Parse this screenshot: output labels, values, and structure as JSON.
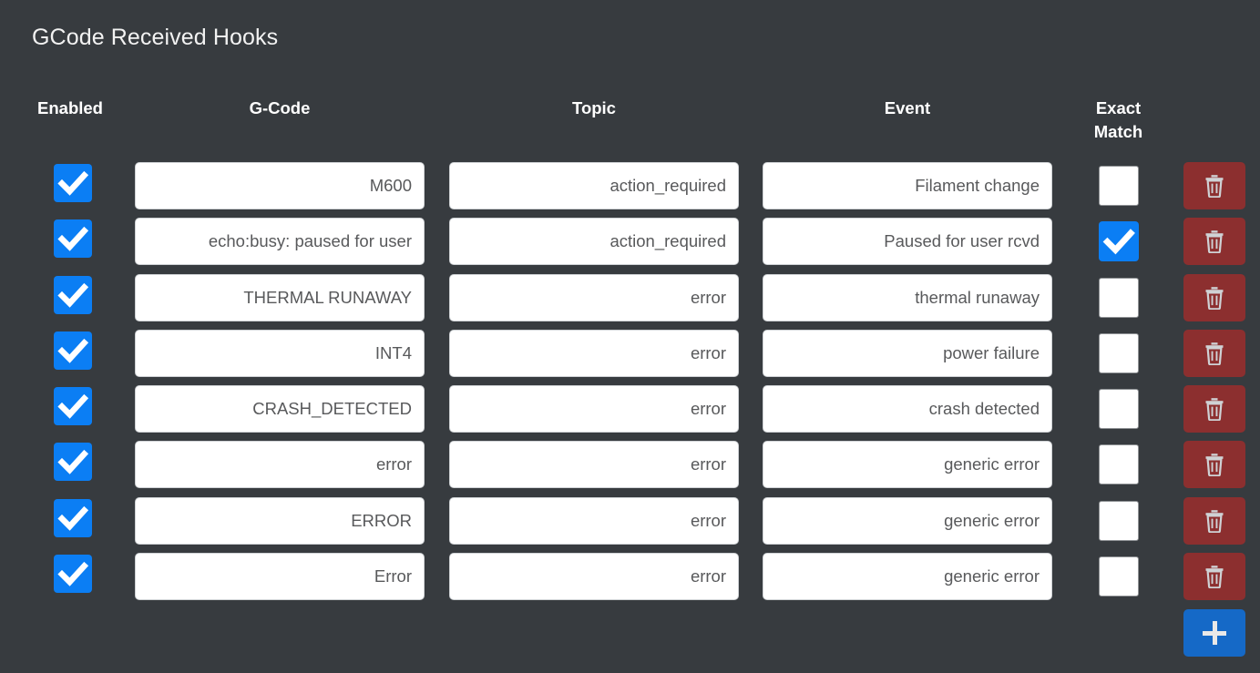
{
  "page": {
    "title": "GCode Received Hooks",
    "background_color": "#373b3f"
  },
  "colors": {
    "accent_blue": "#0b7ef4",
    "delete_red": "#8c2f2f",
    "add_blue": "#1569c7",
    "input_background": "#ffffff",
    "input_text": "#58595b",
    "header_text": "#ffffff"
  },
  "table": {
    "headers": {
      "enabled": "Enabled",
      "gcode": "G-Code",
      "topic": "Topic",
      "event_label": "Event",
      "exact_match_line1": "Exact",
      "exact_match_line2": "Match"
    },
    "rows": [
      {
        "enabled": true,
        "gcode": "M600",
        "topic": "action_required",
        "event": "Filament change",
        "exact_match": false,
        "delete_label": "trash-icon"
      },
      {
        "enabled": true,
        "gcode": "echo:busy: paused for user",
        "topic": "action_required",
        "event": "Paused for user rcvd",
        "exact_match": true,
        "delete_label": "trash-icon"
      },
      {
        "enabled": true,
        "gcode": "THERMAL RUNAWAY",
        "topic": "error",
        "event": "thermal runaway",
        "exact_match": false,
        "delete_label": "trash-icon"
      },
      {
        "enabled": true,
        "gcode": "INT4",
        "topic": "error",
        "event": "power failure",
        "exact_match": false,
        "delete_label": "trash-icon"
      },
      {
        "enabled": true,
        "gcode": "CRASH_DETECTED",
        "topic": "error",
        "event": "crash detected",
        "exact_match": false,
        "delete_label": "trash-icon"
      },
      {
        "enabled": true,
        "gcode": "error",
        "topic": "error",
        "event": "generic error",
        "exact_match": false,
        "delete_label": "trash-icon"
      },
      {
        "enabled": true,
        "gcode": "ERROR",
        "topic": "error",
        "event": "generic error",
        "exact_match": false,
        "delete_label": "trash-icon"
      },
      {
        "enabled": true,
        "gcode": "Error",
        "topic": "error",
        "event": "generic error",
        "exact_match": false,
        "delete_label": "trash-icon"
      }
    ]
  },
  "actions": {
    "add_label": "plus-icon"
  }
}
